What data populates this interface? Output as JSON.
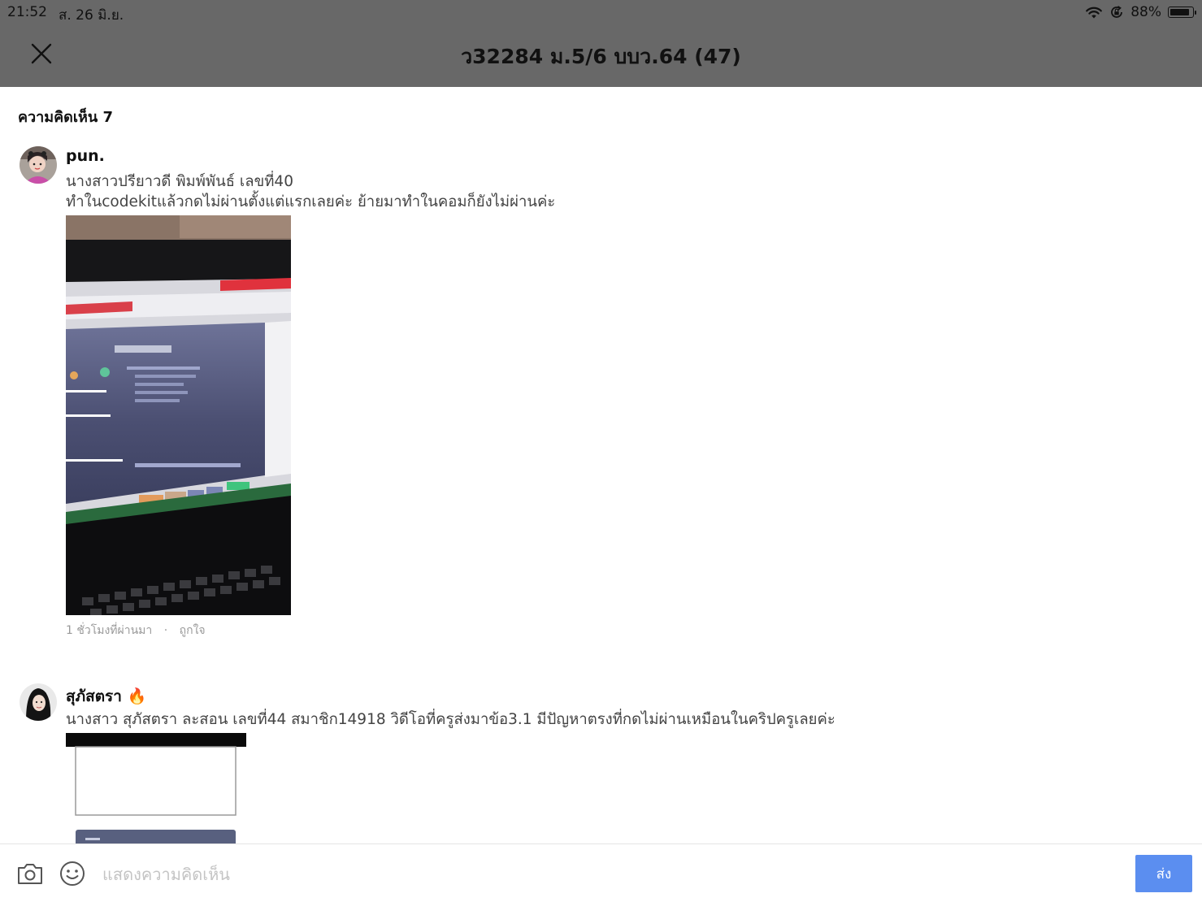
{
  "status_bar": {
    "time": "21:52",
    "date": "ส. 26 มิ.ย.",
    "battery": "88%",
    "battery_level": 0.88
  },
  "header": {
    "title": "ว32284 ม.5/6 บบว.64 (47)"
  },
  "comments_section": {
    "count_label": "ความคิดเห็น 7"
  },
  "comments": [
    {
      "author": "pun.",
      "lines": [
        "นางสาวปรียาวดี พิมพ์พันธ์ เลขที่40",
        "ทำในcodekitแล้วกดไม่ผ่านตั้งแต่แรกเลยค่ะ ย้ายมาทำในคอมก็ยังไม่ผ่านค่ะ"
      ],
      "timestamp": "1 ชั่วโมงที่ผ่านมา",
      "separator": "·",
      "like_label": "ถูกใจ"
    },
    {
      "author": "สุภัสตรา",
      "author_emoji": "🔥",
      "lines": [
        "นางสาว สุภัสตรา ละสอน เลขที่44 สมาชิก14918 วิดีโอที่ครูส่งมาข้อ3.1 มีปัญหาตรงที่กดไม่ผ่านเหมือนในคริปครูเลยค่ะ"
      ]
    }
  ],
  "composer": {
    "placeholder": "แสดงความคิดเห็น",
    "send_label": "ส่ง"
  },
  "colors": {
    "header_bg": "#686868",
    "send_button": "#5b8ef0",
    "placeholder": "#c4c4c4"
  },
  "icons": {
    "close": "close-icon",
    "camera": "camera-icon",
    "emoji": "emoji-icon",
    "wifi": "wifi-icon",
    "orientation_lock": "orientation-lock-icon",
    "battery": "battery-icon"
  }
}
